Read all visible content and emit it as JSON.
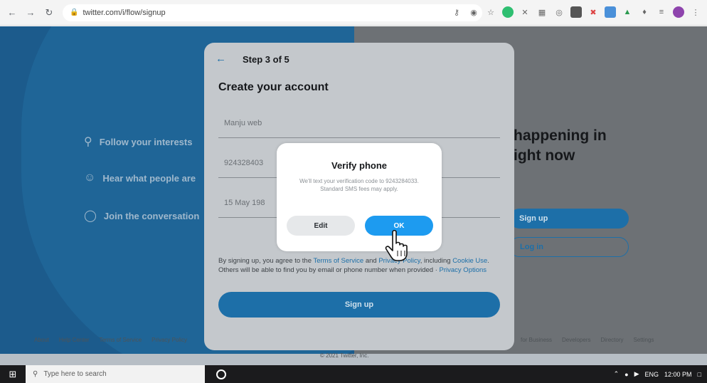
{
  "browser": {
    "back_icon": "back-arrow-icon",
    "forward_icon": "forward-arrow-icon",
    "reload_icon": "reload-icon",
    "url": "twitter.com/i/flow/signup"
  },
  "background": {
    "features": [
      "Follow your interests",
      "Hear what people are",
      "Join the conversation"
    ],
    "headline_line1": "happening in",
    "headline_line2": "ight now",
    "signup_pill": "Sign up",
    "login_pill": "Log in",
    "footer_links_left": [
      "About",
      "Help Center",
      "Terms of Service",
      "Privacy Policy"
    ],
    "footer_links_right": [
      "for Business",
      "Developers",
      "Directory",
      "Settings"
    ],
    "copyright": "© 2021 Twitter, Inc."
  },
  "modal": {
    "step": "Step 3 of 5",
    "title": "Create your account",
    "name_value": "Manju web",
    "phone_value": "924328403",
    "dob_value": "15 May 198",
    "terms_prefix": "By signing up, you agree to the ",
    "terms_tos": "Terms of Service",
    "terms_and": " and ",
    "terms_privacy": "Privacy Policy",
    "terms_including": ", including ",
    "terms_cookie": "Cookie Use",
    "terms_rest": ". Others will be able to find you by email or phone number when provided · ",
    "terms_privacy_options": "Privacy Options",
    "signup_label": "Sign up"
  },
  "dialog": {
    "title": "Verify phone",
    "message": "We'll text your verification code to 9243284033. Standard SMS fees may apply.",
    "edit_label": "Edit",
    "ok_label": "OK"
  },
  "taskbar": {
    "search_placeholder": "Type here to search",
    "language": "ENG",
    "time": "12:00 PM"
  },
  "colors": {
    "twitter_blue": "#1d9bf0",
    "overlay_blue": "#1c5b8c"
  }
}
